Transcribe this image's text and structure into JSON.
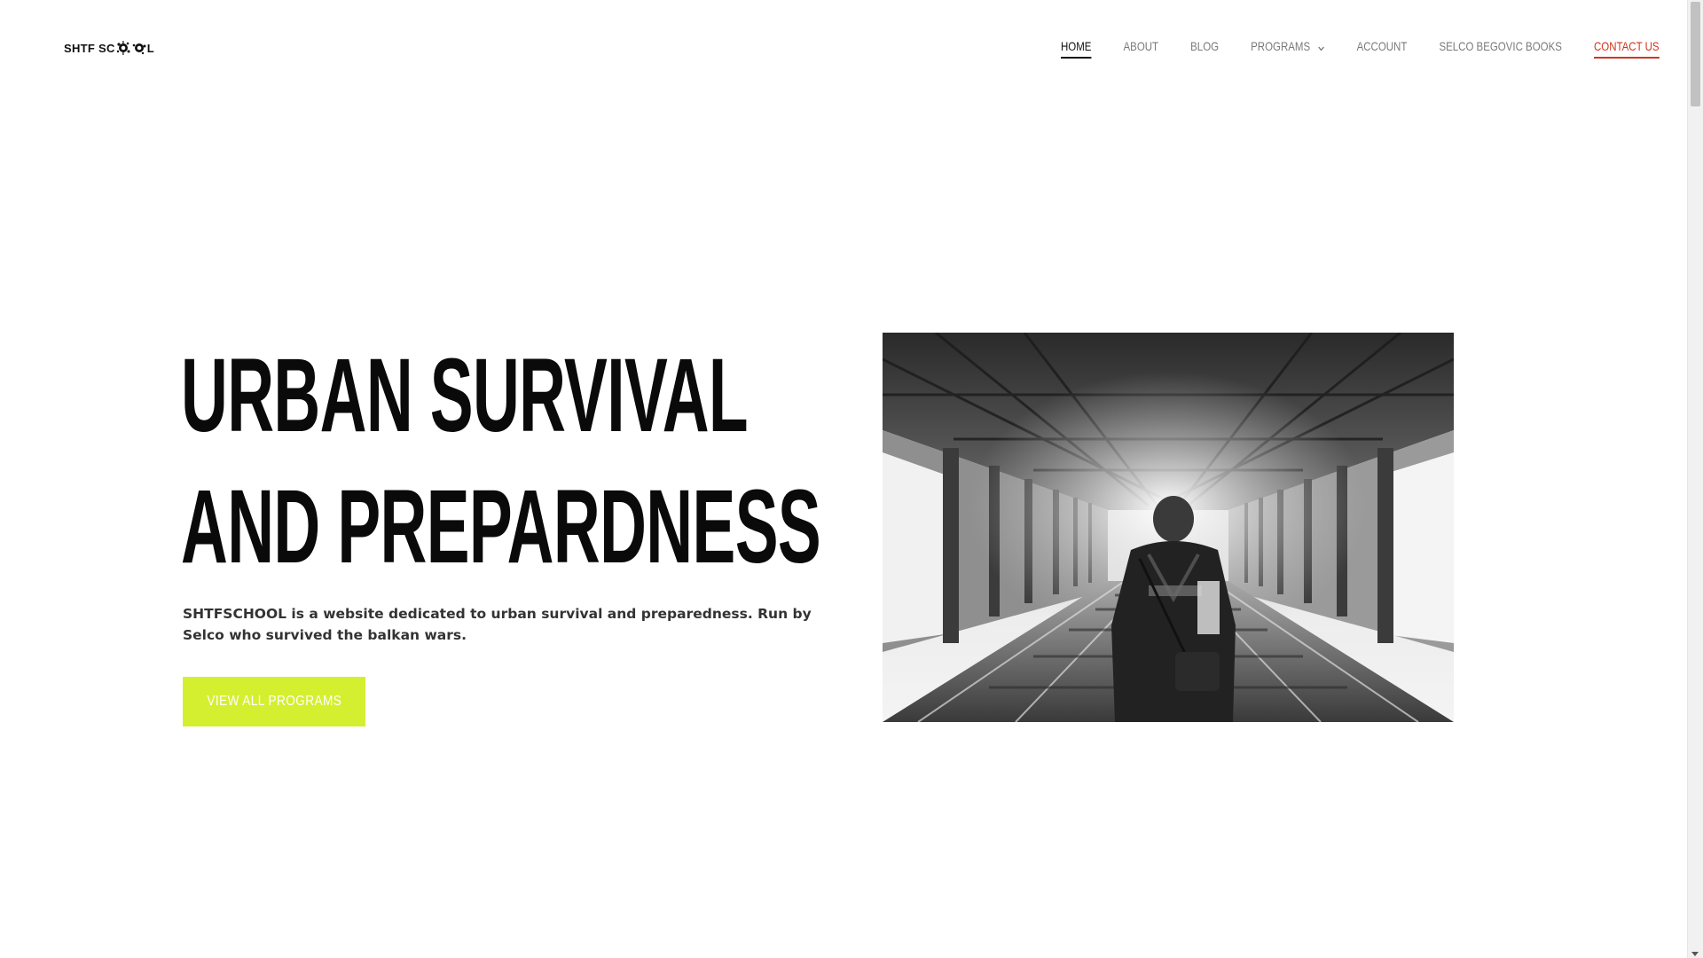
{
  "header": {
    "logo_text_left": "SHTF SC",
    "logo_text_right": "L",
    "nav": [
      {
        "label": "HOME"
      },
      {
        "label": "ABOUT"
      },
      {
        "label": "BLOG"
      },
      {
        "label": "PROGRAMS"
      },
      {
        "label": "ACCOUNT"
      },
      {
        "label": "SELCO BEGOVIC BOOKS"
      },
      {
        "label": "CONTACT US"
      }
    ]
  },
  "hero": {
    "title_line1": "URBAN SURVIVAL",
    "title_line2": "AND PREPARDNESS",
    "description": "SHTFSCHOOL is a website dedicated to urban survival and preparedness. Run by Selco who survived the balkan wars.",
    "cta_label": "VIEW ALL PROGRAMS"
  },
  "colors": {
    "accent": "#d4ef2f",
    "contact": "#d0341c",
    "nav_text": "#7a7a7a"
  },
  "icons": {
    "dropdown": "chevron-down-icon",
    "logo": "ink-splat-icon"
  }
}
